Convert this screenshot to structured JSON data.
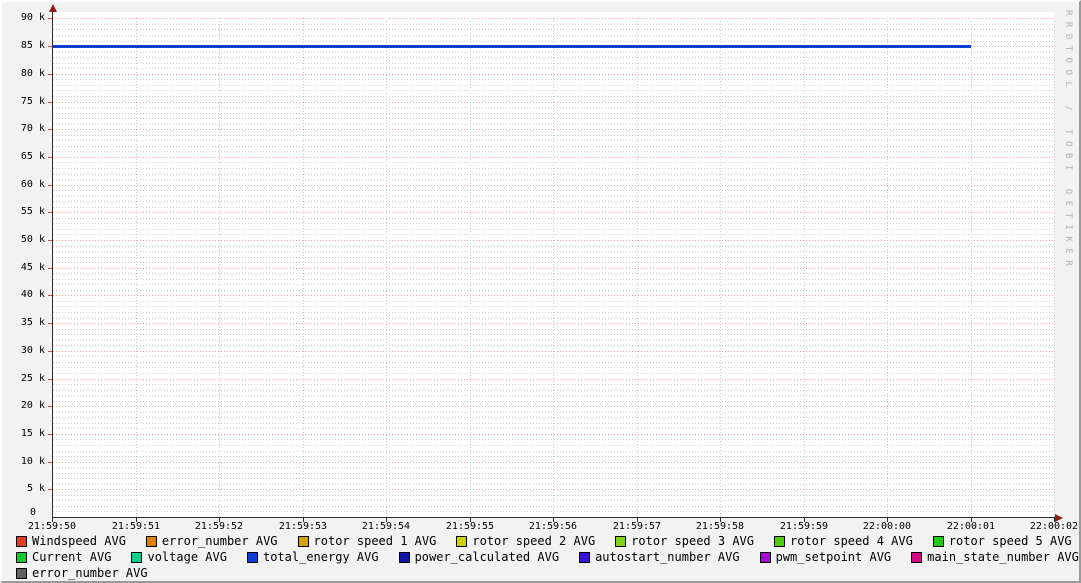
{
  "watermark": "RRDTOOL / TOBI OETIKER",
  "chart_data": {
    "type": "line",
    "title": "",
    "xlabel": "",
    "ylabel": "",
    "x_ticks": [
      "21:59:50",
      "21:59:51",
      "21:59:52",
      "21:59:53",
      "21:59:54",
      "21:59:55",
      "21:59:56",
      "21:59:57",
      "21:59:58",
      "21:59:59",
      "22:00:00",
      "22:00:01",
      "22:00:02"
    ],
    "ylim": [
      0,
      90000
    ],
    "y_tick_step": 5000,
    "y_minor_step": 1000,
    "y_tick_labels": [
      "0",
      "5 k",
      "10 k",
      "15 k",
      "20 k",
      "25 k",
      "30 k",
      "35 k",
      "40 k",
      "45 k",
      "50 k",
      "55 k",
      "60 k",
      "65 k",
      "70 k",
      "75 k",
      "80 k",
      "85 k",
      "90 k"
    ],
    "grid": true,
    "legend_position": "bottom",
    "series": [
      {
        "name": "Windspeed AVG",
        "color": "#e33b24",
        "constant_value": null
      },
      {
        "name": "error_number AVG",
        "color": "#e07e00",
        "constant_value": null
      },
      {
        "name": "rotor speed 1 AVG",
        "color": "#d2a500",
        "constant_value": null
      },
      {
        "name": "rotor speed 2 AVG",
        "color": "#cdd100",
        "constant_value": null
      },
      {
        "name": "rotor speed 3 AVG",
        "color": "#7fd318",
        "constant_value": null
      },
      {
        "name": "rotor speed 4 AVG",
        "color": "#4ccd10",
        "constant_value": null
      },
      {
        "name": "rotor speed 5 AVG",
        "color": "#1ecb10",
        "constant_value": null
      },
      {
        "name": "Current AVG",
        "color": "#0ccb2c",
        "constant_value": null
      },
      {
        "name": "voltage AVG",
        "color": "#0bd08e",
        "constant_value": null
      },
      {
        "name": "total_energy AVG",
        "color": "#0d3fd4",
        "constant_value": 85000,
        "x_start": "21:59:50",
        "x_end": "22:00:01",
        "line_width": 3
      },
      {
        "name": "power_calculated AVG",
        "color": "#1216a5",
        "constant_value": null
      },
      {
        "name": "autostart_number AVG",
        "color": "#3913d2",
        "constant_value": null
      },
      {
        "name": "pwm_setpoint AVG",
        "color": "#a60cd4",
        "constant_value": null
      },
      {
        "name": "main_state_number AVG",
        "color": "#d40b84",
        "constant_value": null
      },
      {
        "name": "error_number AVG",
        "color": "#5f5f5f",
        "constant_value": null
      }
    ]
  },
  "legend": {
    "rows": [
      [
        0,
        1,
        2,
        3,
        4,
        5,
        6
      ],
      [
        7,
        8,
        9,
        10,
        11,
        12,
        13
      ],
      [
        14
      ]
    ]
  }
}
